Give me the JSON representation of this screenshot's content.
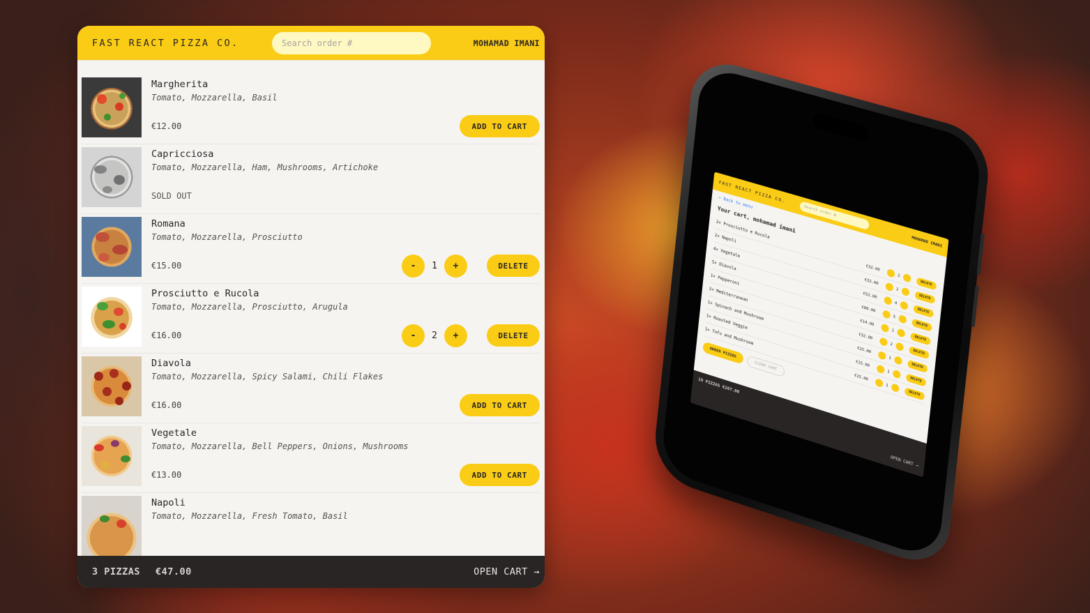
{
  "header": {
    "logo": "FAST REACT PIZZA CO.",
    "search_placeholder": "Search order #",
    "username": "MOHAMAD IMANI"
  },
  "menu": [
    {
      "name": "Margherita",
      "ingredients": "Tomato, Mozzarella, Basil",
      "price": "€12.00",
      "sold_out": false,
      "in_cart": false,
      "button": "ADD TO CART"
    },
    {
      "name": "Capricciosa",
      "ingredients": "Tomato, Mozzarella, Ham, Mushrooms, Artichoke",
      "price": "",
      "sold_out": true,
      "sold_out_label": "SOLD OUT"
    },
    {
      "name": "Romana",
      "ingredients": "Tomato, Mozzarella, Prosciutto",
      "price": "€15.00",
      "sold_out": false,
      "in_cart": true,
      "quantity": "1",
      "button": "DELETE"
    },
    {
      "name": "Prosciutto e Rucola",
      "ingredients": "Tomato, Mozzarella, Prosciutto, Arugula",
      "price": "€16.00",
      "sold_out": false,
      "in_cart": true,
      "quantity": "2",
      "button": "DELETE"
    },
    {
      "name": "Diavola",
      "ingredients": "Tomato, Mozzarella, Spicy Salami, Chili Flakes",
      "price": "€16.00",
      "sold_out": false,
      "in_cart": false,
      "button": "ADD TO CART"
    },
    {
      "name": "Vegetale",
      "ingredients": "Tomato, Mozzarella, Bell Peppers, Onions, Mushrooms",
      "price": "€13.00",
      "sold_out": false,
      "in_cart": false,
      "button": "ADD TO CART"
    },
    {
      "name": "Napoli",
      "ingredients": "Tomato, Mozzarella, Fresh Tomato, Basil",
      "price": "",
      "sold_out": false,
      "in_cart": false,
      "button": ""
    }
  ],
  "cart_bar": {
    "count": "3 PIZZAS",
    "total": "€47.00",
    "open_label": "OPEN CART →"
  },
  "phone": {
    "logo": "FAST REACT PIZZA CO.",
    "search_placeholder": "Search order #",
    "username": "MOHAMAD IMANI",
    "back_link": "← Back to menu",
    "cart_title": "Your cart, mohamad imani",
    "items": [
      {
        "name": "2× Prosciutto e Rucola",
        "price": "€32.00",
        "qty": "2"
      },
      {
        "name": "2× Napoli",
        "price": "€32.00",
        "qty": "2"
      },
      {
        "name": "4× Vegetale",
        "price": "€52.00",
        "qty": "4"
      },
      {
        "name": "5× Diavola",
        "price": "€80.00",
        "qty": "5"
      },
      {
        "name": "1× Pepperoni",
        "price": "€14.00",
        "qty": "1"
      },
      {
        "name": "2× Mediterranean",
        "price": "€32.00",
        "qty": "2"
      },
      {
        "name": "1× Spinach and Mushroom",
        "price": "€15.00",
        "qty": "1"
      },
      {
        "name": "1× Roasted Veggie",
        "price": "€15.00",
        "qty": "1"
      },
      {
        "name": "1× Tofu and Mushroom",
        "price": "€15.00",
        "qty": "1"
      }
    ],
    "delete_label": "DELETE",
    "order_button": "ORDER PIZZAS",
    "clear_button": "CLEAR CART",
    "footer_summary": "19 PIZZAS  €267.00",
    "footer_open": "OPEN CART →"
  },
  "colors": {
    "accent": "#facc15",
    "dark": "#292524",
    "background": "#f5f4f1"
  }
}
